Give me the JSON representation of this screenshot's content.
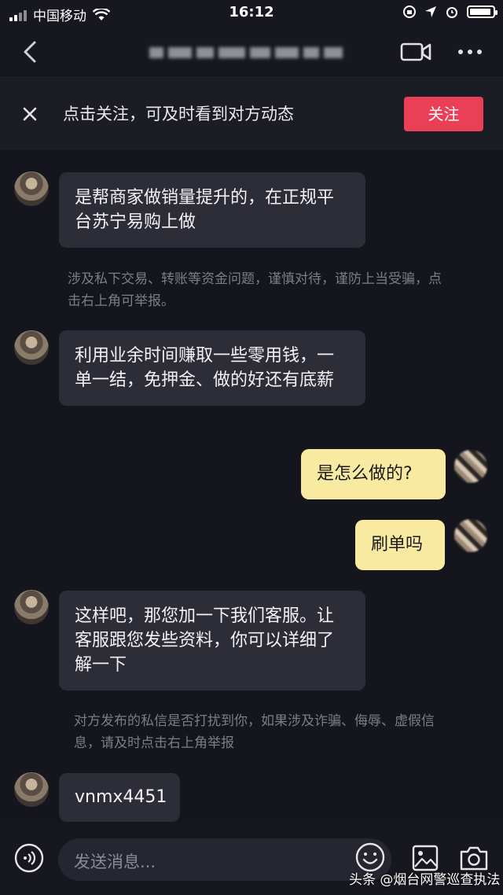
{
  "status_bar": {
    "carrier": "中国移动",
    "time": "16:12"
  },
  "nav": {
    "back_icon": "chevron-left-icon",
    "video_icon": "video-call-icon",
    "more_icon": "more-dots-icon"
  },
  "follow_banner": {
    "text": "点击关注，可及时看到对方动态",
    "button": "关注",
    "button_color": "#e94057"
  },
  "messages": [
    {
      "from": "other",
      "text": "是帮商家做销量提升的，在正规平台苏宁易购上做"
    },
    {
      "from": "other",
      "text": "利用业余时间赚取一些零用钱，一单一结，免押金、做的好还有底薪"
    },
    {
      "from": "me",
      "text": "是怎么做的?"
    },
    {
      "from": "me",
      "text": "刷单吗"
    },
    {
      "from": "other",
      "text": "这样吧，那您加一下我们客服。让客服跟您发些资料，你可以详细了解一下"
    },
    {
      "from": "other",
      "text": "vnmx4451"
    }
  ],
  "notices": [
    "涉及私下交易、转账等资金问题，谨慎对待，谨防上当受骗，点击右上角可举报。",
    "对方发布的私信是否打扰到你，如果涉及诈骗、侮辱、虚假信息，请及时点击右上角举报"
  ],
  "input_bar": {
    "placeholder": "发送消息...",
    "voice_icon": "voice-icon",
    "emoji_icon": "emoji-icon",
    "image_icon": "image-icon",
    "camera_icon": "camera-icon"
  },
  "watermark": "头条 @烟台网警巡查执法",
  "colors": {
    "background": "#15151d",
    "bubble_other": "#2d2d37",
    "bubble_me": "#f8eba1"
  }
}
